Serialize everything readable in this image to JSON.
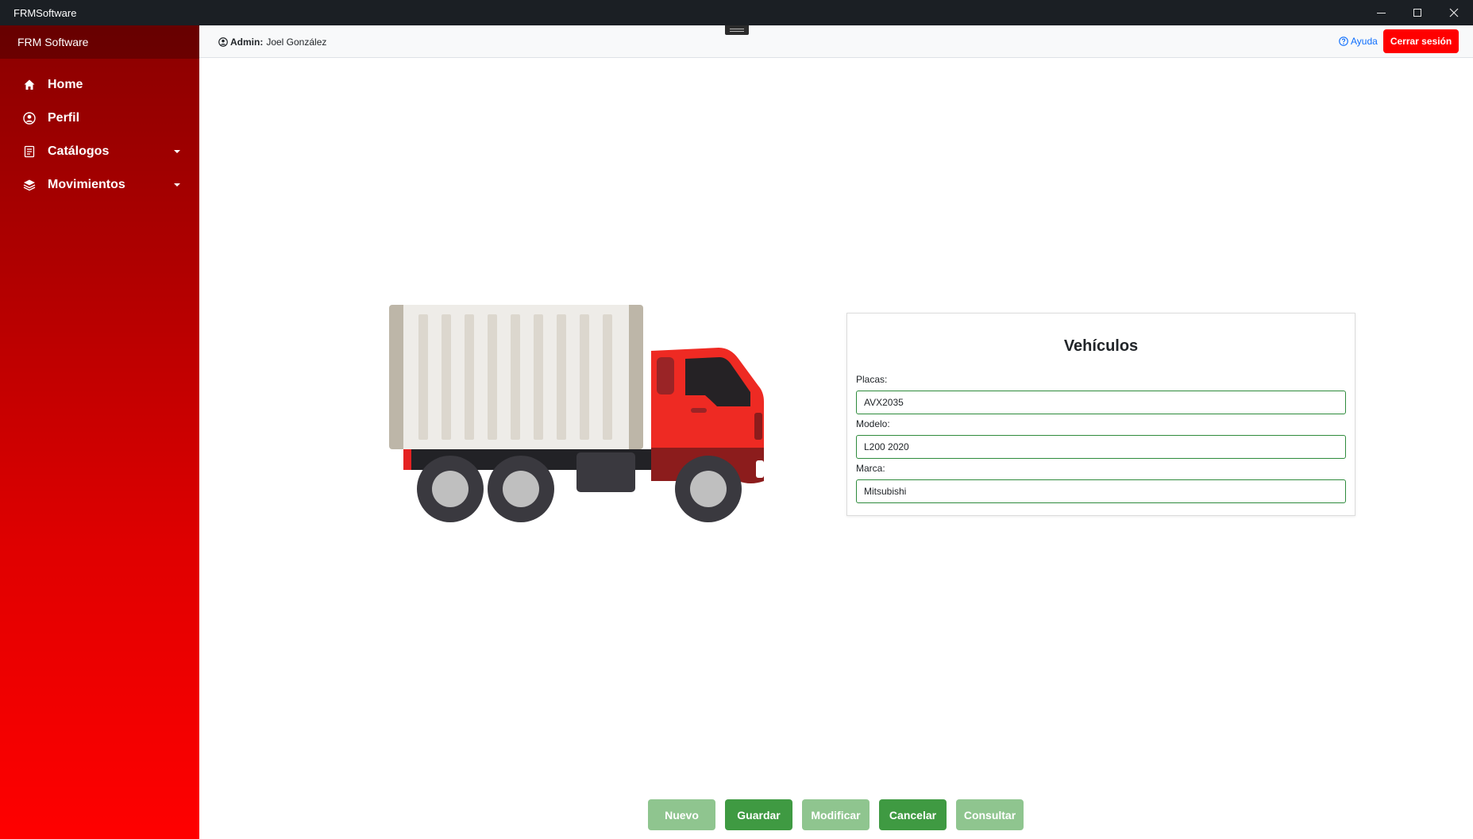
{
  "window": {
    "title": "FRMSoftware"
  },
  "sidebar": {
    "brand": "FRM Software",
    "items": [
      {
        "label": "Home",
        "icon": "home-icon"
      },
      {
        "label": "Perfil",
        "icon": "user-circle-icon"
      },
      {
        "label": "Catálogos",
        "icon": "catalog-icon",
        "has_submenu": true
      },
      {
        "label": "Movimientos",
        "icon": "layers-icon",
        "has_submenu": true
      }
    ]
  },
  "header": {
    "role_label": "Admin:",
    "user_name": "Joel González",
    "help_label": "Ayuda",
    "logout_label": "Cerrar sesión"
  },
  "form": {
    "title": "Vehículos",
    "fields": [
      {
        "label": "Placas:",
        "value": "AVX2035"
      },
      {
        "label": "Modelo:",
        "value": "L200 2020"
      },
      {
        "label": "Marca:",
        "value": "Mitsubishi"
      }
    ]
  },
  "actions": [
    {
      "label": "Nuevo",
      "enabled": false
    },
    {
      "label": "Guardar",
      "enabled": true
    },
    {
      "label": "Modificar",
      "enabled": false
    },
    {
      "label": "Cancelar",
      "enabled": true
    },
    {
      "label": "Consultar",
      "enabled": false
    }
  ],
  "colors": {
    "sidebar_top": "#8a0000",
    "sidebar_bottom": "#ff0000",
    "logout_button": "#ff0000",
    "button_enabled": "#3f9a42",
    "button_disabled": "#8fc58f",
    "input_border": "#2e8b3c",
    "link": "#0d6efd"
  }
}
